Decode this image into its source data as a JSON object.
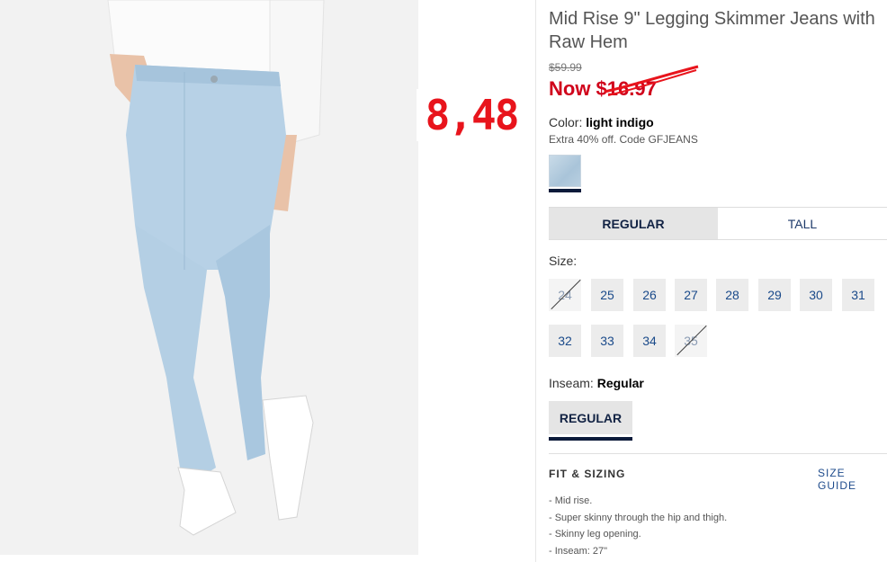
{
  "product": {
    "title": "Mid Rise 9\" Legging Skimmer Jeans with Raw Hem",
    "original_price": "$59.99",
    "sale_price": "Now $16.97",
    "annotated_price": "8,48"
  },
  "color": {
    "label": "Color:",
    "value": "light indigo",
    "promo": "Extra 40% off. Code GFJEANS",
    "swatch_color": "#b3cbdd"
  },
  "fit_tabs": [
    {
      "label": "REGULAR",
      "active": true
    },
    {
      "label": "TALL",
      "active": false
    }
  ],
  "size": {
    "label": "Size:",
    "options": [
      {
        "label": "24",
        "available": false
      },
      {
        "label": "25",
        "available": true
      },
      {
        "label": "26",
        "available": true
      },
      {
        "label": "27",
        "available": true
      },
      {
        "label": "28",
        "available": true
      },
      {
        "label": "29",
        "available": true
      },
      {
        "label": "30",
        "available": true
      },
      {
        "label": "31",
        "available": true
      },
      {
        "label": "32",
        "available": true
      },
      {
        "label": "33",
        "available": true
      },
      {
        "label": "34",
        "available": true
      },
      {
        "label": "35",
        "available": false
      }
    ]
  },
  "inseam": {
    "label": "Inseam:",
    "value": "Regular",
    "option": "REGULAR"
  },
  "fit_sizing": {
    "heading": "FIT & SIZING",
    "size_guide": "SIZE GUIDE",
    "bullets": [
      "- Mid rise.",
      "- Super skinny through the hip and thigh.",
      "- Skinny leg opening.",
      "- Inseam: 27\""
    ]
  },
  "colors": {
    "sale_red": "#d0021b",
    "annotation_red": "#e8141c",
    "navy": "#0b1a3a",
    "link_blue": "#1e4b8c"
  }
}
